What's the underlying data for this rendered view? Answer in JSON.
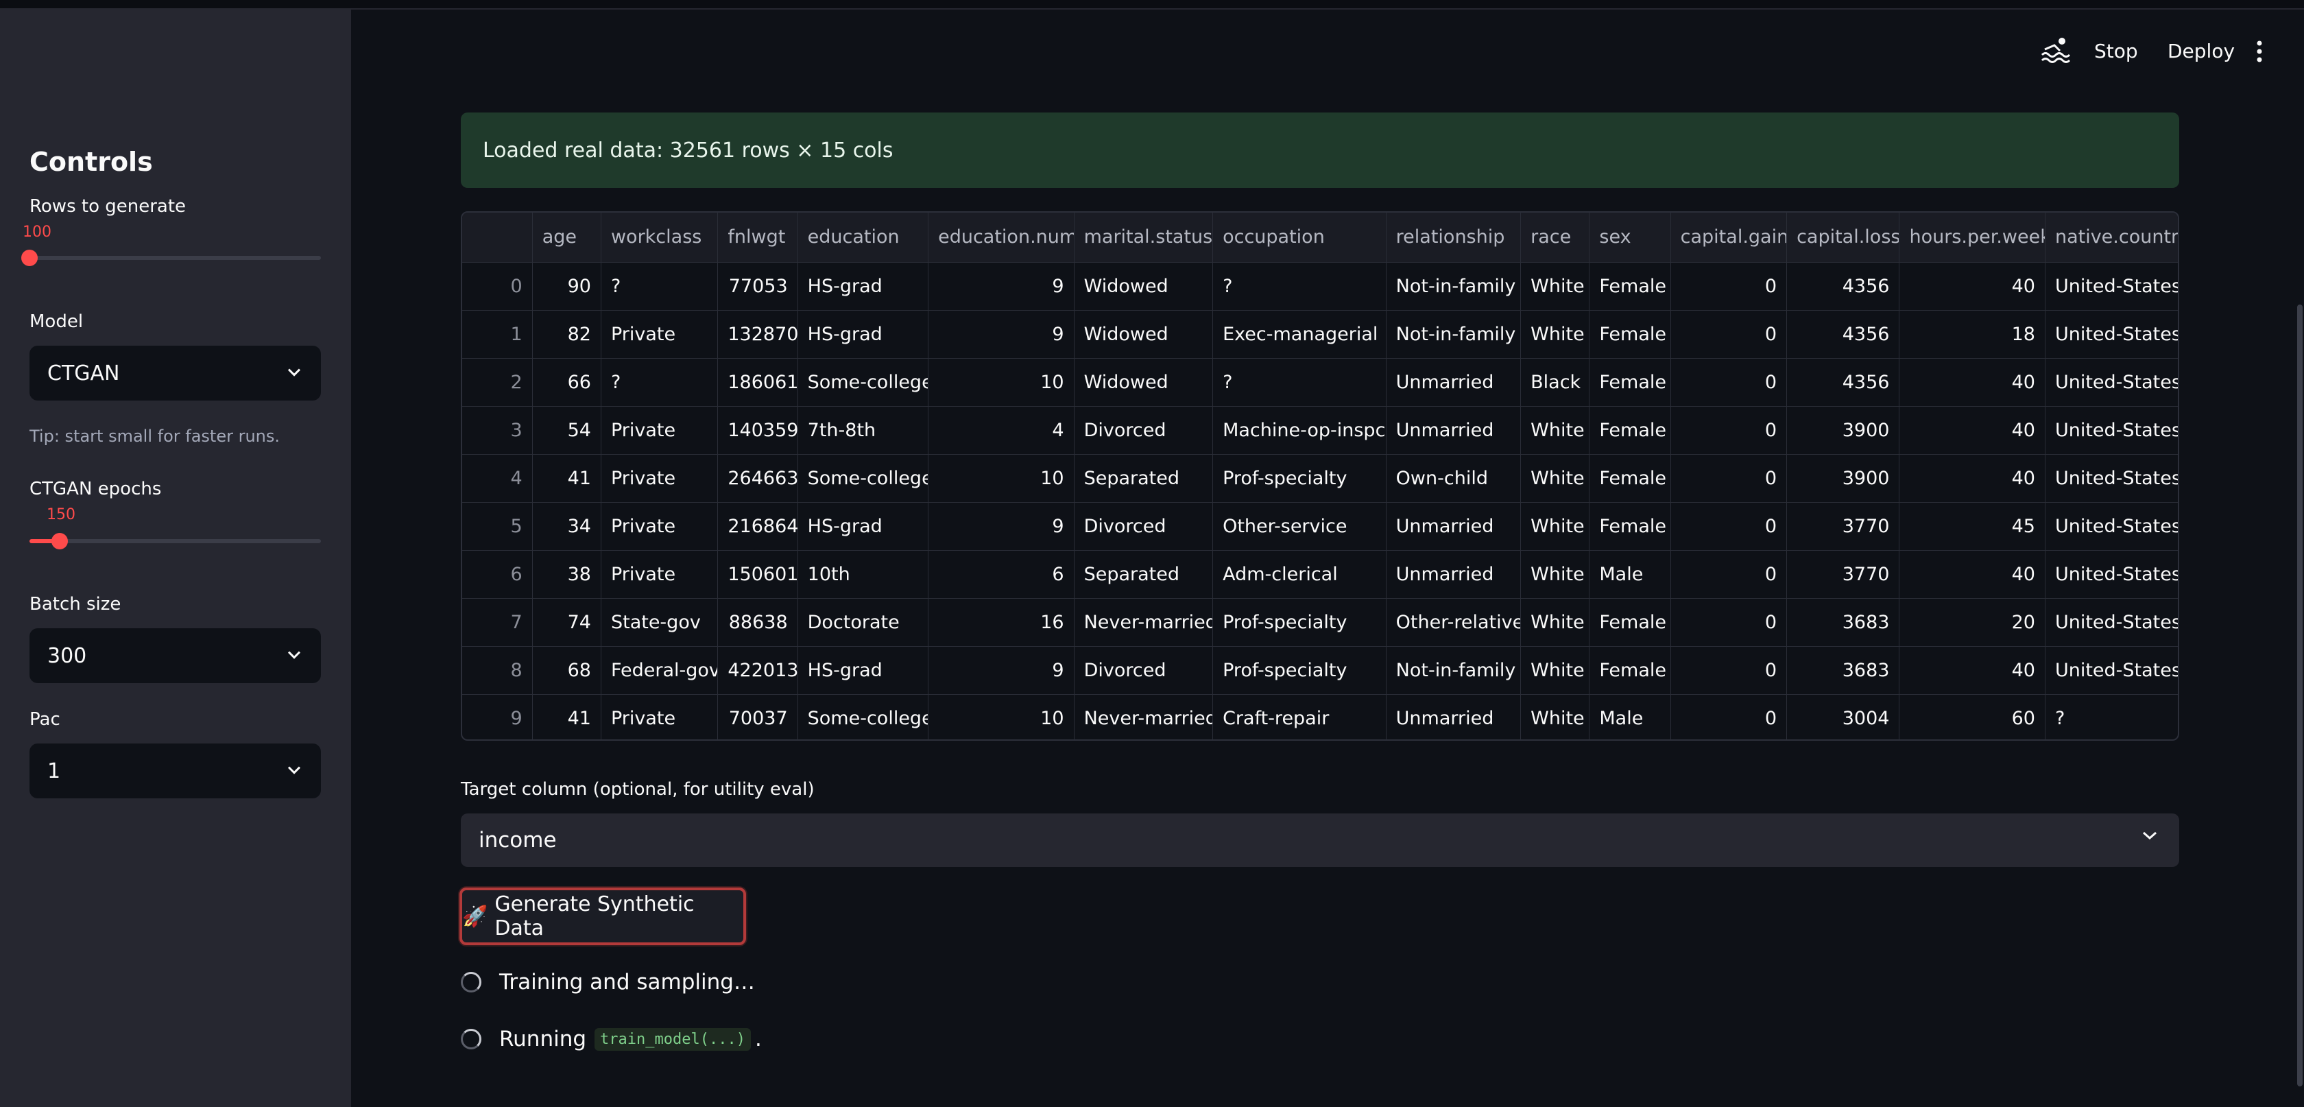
{
  "header": {
    "stop_label": "Stop",
    "deploy_label": "Deploy"
  },
  "sidebar": {
    "title": "Controls",
    "rows_label": "Rows to generate",
    "rows_value": "100",
    "rows_fraction": 0.0,
    "model_label": "Model",
    "model_value": "CTGAN",
    "tip": "Tip: start small for faster runs.",
    "epochs_label": "CTGAN epochs",
    "epochs_value": "150",
    "epochs_fraction": 0.1,
    "batch_label": "Batch size",
    "batch_value": "300",
    "pac_label": "Pac",
    "pac_value": "1"
  },
  "main": {
    "alert": "Loaded real data: 32561 rows × 15 cols",
    "table": {
      "columns": [
        "",
        "age",
        "workclass",
        "fnlwgt",
        "education",
        "education.num",
        "marital.status",
        "occupation",
        "relationship",
        "race",
        "sex",
        "capital.gain",
        "capital.loss",
        "hours.per.week",
        "native.country"
      ],
      "rows": [
        [
          "0",
          "90",
          "?",
          "77053",
          "HS-grad",
          "9",
          "Widowed",
          "?",
          "Not-in-family",
          "White",
          "Female",
          "0",
          "4356",
          "40",
          "United-States"
        ],
        [
          "1",
          "82",
          "Private",
          "132870",
          "HS-grad",
          "9",
          "Widowed",
          "Exec-managerial",
          "Not-in-family",
          "White",
          "Female",
          "0",
          "4356",
          "18",
          "United-States"
        ],
        [
          "2",
          "66",
          "?",
          "186061",
          "Some-college",
          "10",
          "Widowed",
          "?",
          "Unmarried",
          "Black",
          "Female",
          "0",
          "4356",
          "40",
          "United-States"
        ],
        [
          "3",
          "54",
          "Private",
          "140359",
          "7th-8th",
          "4",
          "Divorced",
          "Machine-op-inspct",
          "Unmarried",
          "White",
          "Female",
          "0",
          "3900",
          "40",
          "United-States"
        ],
        [
          "4",
          "41",
          "Private",
          "264663",
          "Some-college",
          "10",
          "Separated",
          "Prof-specialty",
          "Own-child",
          "White",
          "Female",
          "0",
          "3900",
          "40",
          "United-States"
        ],
        [
          "5",
          "34",
          "Private",
          "216864",
          "HS-grad",
          "9",
          "Divorced",
          "Other-service",
          "Unmarried",
          "White",
          "Female",
          "0",
          "3770",
          "45",
          "United-States"
        ],
        [
          "6",
          "38",
          "Private",
          "150601",
          "10th",
          "6",
          "Separated",
          "Adm-clerical",
          "Unmarried",
          "White",
          "Male",
          "0",
          "3770",
          "40",
          "United-States"
        ],
        [
          "7",
          "74",
          "State-gov",
          "88638",
          "Doctorate",
          "16",
          "Never-married",
          "Prof-specialty",
          "Other-relative",
          "White",
          "Female",
          "0",
          "3683",
          "20",
          "United-States"
        ],
        [
          "8",
          "68",
          "Federal-gov",
          "422013",
          "HS-grad",
          "9",
          "Divorced",
          "Prof-specialty",
          "Not-in-family",
          "White",
          "Female",
          "0",
          "3683",
          "40",
          "United-States"
        ],
        [
          "9",
          "41",
          "Private",
          "70037",
          "Some-college",
          "10",
          "Never-married",
          "Craft-repair",
          "Unmarried",
          "White",
          "Male",
          "0",
          "3004",
          "60",
          "?"
        ]
      ]
    },
    "target_label": "Target column (optional, for utility eval)",
    "target_value": "income",
    "generate_icon": "🚀",
    "generate_label": "Generate Synthetic Data",
    "status1": "Training and sampling…",
    "status2_prefix": "Running",
    "status2_code": "train_model(...)",
    "status2_suffix": "."
  },
  "colors": {
    "accent": "#ff4b4b",
    "alert_bg": "#1f3a2b",
    "sidebar_bg": "#262730",
    "main_bg": "#0e1117"
  }
}
